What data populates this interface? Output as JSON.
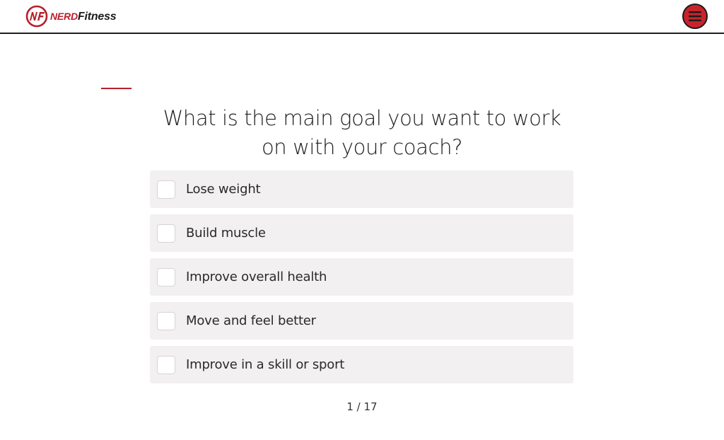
{
  "header": {
    "logo": {
      "nerd_text": "NERD",
      "fitness_text": "Fitness",
      "mark_text": "NF"
    },
    "menu_icon": "hamburger-icon"
  },
  "colors": {
    "brand_red": "#b71f2b",
    "menu_red": "#c8232c",
    "option_bg": "#f2f0f1"
  },
  "quiz": {
    "question": "What is the main goal you want to work on with your coach?",
    "options": [
      {
        "label": "Lose weight",
        "checked": false
      },
      {
        "label": "Build muscle",
        "checked": false
      },
      {
        "label": "Improve overall health",
        "checked": false
      },
      {
        "label": "Move and feel better",
        "checked": false
      },
      {
        "label": "Improve in a skill or sport",
        "checked": false
      }
    ],
    "progress": "1 / 17"
  }
}
